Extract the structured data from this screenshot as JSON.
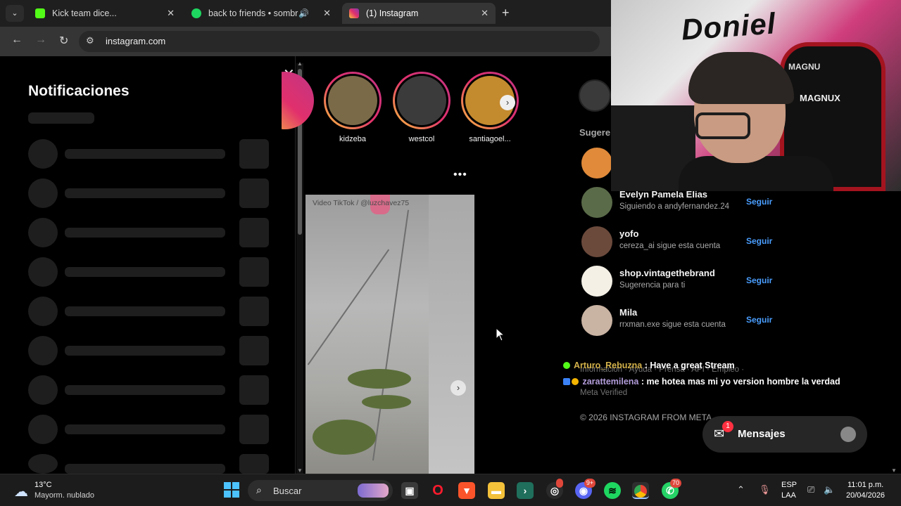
{
  "browser": {
    "tabs": [
      {
        "title": "Kick team dice...",
        "favicon_color": "#53fc18",
        "active": false
      },
      {
        "title": "back to friends • sombr",
        "favicon_color": "#1ed760",
        "active": false
      },
      {
        "title": "(1) Instagram",
        "favicon_color": "#e1306c",
        "active": true
      }
    ],
    "new_tab_glyph": "+",
    "url": "instagram.com"
  },
  "notifications": {
    "title": "Notificaciones",
    "close_glyph": "✕"
  },
  "stories": [
    {
      "name": "kidzeba",
      "color": "#7a6a48"
    },
    {
      "name": "westcol",
      "color": "#3b3b3b"
    },
    {
      "name": "santiagoel...",
      "color": "#c48a2e"
    }
  ],
  "post": {
    "more_glyph": "•••",
    "watermark": "Video TikTok / @luzchavez75"
  },
  "suggestions": {
    "heading": "Sugeren",
    "items": [
      {
        "name": "Evelyn Pamela Elias",
        "sub": "Siguiendo a andyfernandez.24",
        "button": "Seguir",
        "avatar_color": "#5a6b49"
      },
      {
        "name": "yofo",
        "sub": "cereza_ai sigue esta cuenta",
        "button": "Seguir",
        "avatar_color": "#6b4a3c"
      },
      {
        "name": "shop.vintagethebrand",
        "sub": "Sugerencia para ti",
        "button": "Seguir",
        "avatar_color": "#f4f0e6"
      },
      {
        "name": "Mila",
        "sub": "rrxman.exe sigue esta cuenta",
        "button": "Seguir",
        "avatar_color": "#c9b3a2"
      }
    ]
  },
  "chat": [
    {
      "user": "Arturo_Rebuzna",
      "text": " : Have a great Stream"
    },
    {
      "user": "zarattemilena",
      "text": " : me hotea mas mi yo version hombre la verdad"
    }
  ],
  "footer": {
    "links": "Información · Ayuda · Prensa · API · Empleo ·",
    "meta_verified": "Meta Verified",
    "copyright": "© 2026 INSTAGRAM FROM META"
  },
  "messages_pill": {
    "label": "Mensajes",
    "badge": "1"
  },
  "webcam": {
    "graffiti_text": "Doniel",
    "chair_brand_top": "MAGNU",
    "chair_brand": "MAGNUX"
  },
  "taskbar": {
    "temperature": "13°C",
    "weather_desc": "Mayorm. nublado",
    "search_label": "Buscar",
    "discord_badge": "9+",
    "whatsapp_badge": "70",
    "lang": "ESP",
    "lang_sub": "LAA",
    "time": "11:01 p.m.",
    "date": "20/04/2026"
  }
}
